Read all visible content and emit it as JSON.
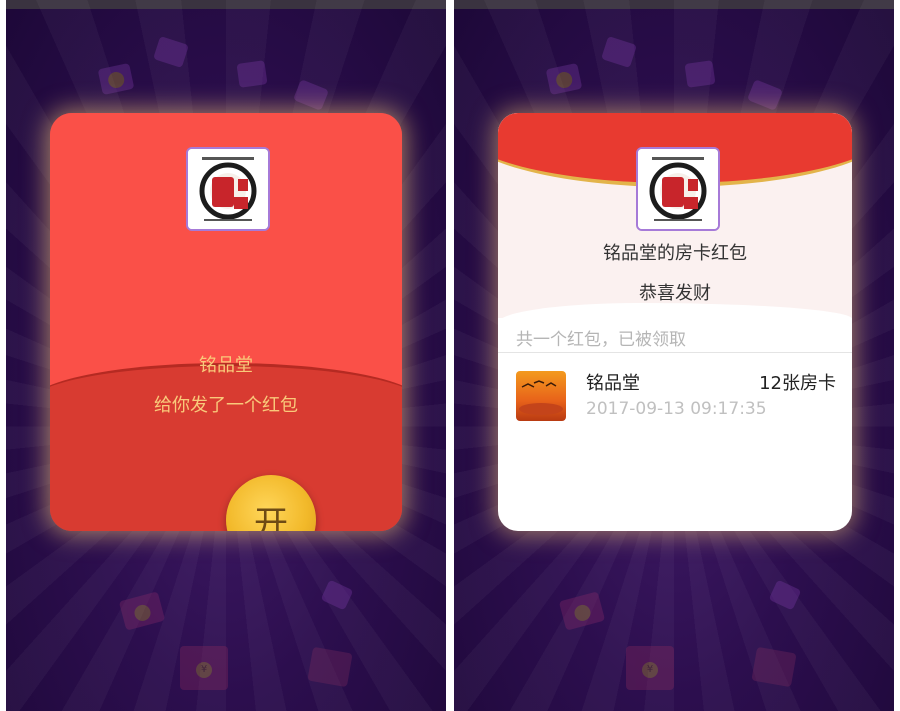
{
  "left_envelope": {
    "sender_name": "铭品堂",
    "message": "给你发了一个红包",
    "open_button_label": "开",
    "logo_icon": "brand-logo-icon"
  },
  "right_envelope": {
    "title": "铭品堂的房卡红包",
    "greeting": "恭喜发财",
    "summary": "共一个红包，已被领取",
    "records": [
      {
        "name": "铭品堂",
        "amount": "12张房卡",
        "time": "2017-09-13 09:17:35"
      }
    ]
  },
  "colors": {
    "background_purple": "#2c0e4e",
    "envelope_red": "#f54b46",
    "accent_gold": "#f9c97a",
    "coin_gold": "#f2b92a"
  }
}
